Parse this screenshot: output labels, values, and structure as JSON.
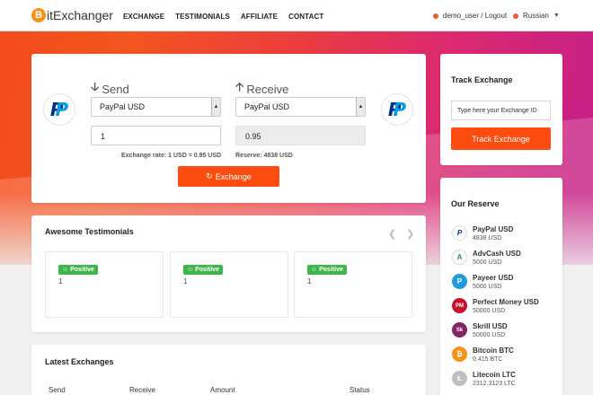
{
  "header": {
    "logo_letter": "B",
    "logo_text": "itExchanger",
    "nav": [
      "EXCHANGE",
      "TESTIMONIALS",
      "AFFILIATE",
      "CONTACT"
    ],
    "user": "demo_user / Logout",
    "language": "Russian"
  },
  "exchange": {
    "send_label": "Send",
    "receive_label": "Receive",
    "send_currency": "PayPal USD",
    "receive_currency": "PayPal USD",
    "send_amount": "1",
    "receive_amount": "0.95",
    "rate_text": "Exchange rate: 1 USD = 0.95 USD",
    "reserve_text": "Reserve: 4838 USD",
    "button_label": "Exchange"
  },
  "track": {
    "title": "Track Exchange",
    "input_placeholder": "Type here your Exchange ID",
    "button_label": "Track Exchange"
  },
  "reserve": {
    "title": "Our Reserve",
    "items": [
      {
        "name": "PayPal USD",
        "amount": "4838 USD",
        "color": "#ffffff",
        "icon": "paypal-icon"
      },
      {
        "name": "AdvCash USD",
        "amount": "5000 USD",
        "color": "#2e8b57",
        "icon": "advcash-icon"
      },
      {
        "name": "Payeer USD",
        "amount": "5000 USD",
        "color": "#1e9be0",
        "icon": "payeer-icon"
      },
      {
        "name": "Perfect Money USD",
        "amount": "50000 USD",
        "color": "#c8102e",
        "icon": "perfect-money-icon"
      },
      {
        "name": "Skrill USD",
        "amount": "50000 USD",
        "color": "#862165",
        "icon": "skrill-icon"
      },
      {
        "name": "Bitcoin BTC",
        "amount": "0.415 BTC",
        "color": "#f7931a",
        "icon": "bitcoin-icon"
      },
      {
        "name": "Litecoin LTC",
        "amount": "2312.3123 LTC",
        "color": "#bfbfbf",
        "icon": "litecoin-icon"
      }
    ]
  },
  "testimonials": {
    "title": "Awesome Testimonials",
    "items": [
      {
        "badge": "Positive",
        "text": "1"
      },
      {
        "badge": "Positive",
        "text": "1"
      },
      {
        "badge": "Positive",
        "text": "1"
      }
    ]
  },
  "latest": {
    "title": "Latest Exchanges",
    "columns": [
      "Send",
      "Receive",
      "Amount",
      "Status"
    ]
  },
  "colors": {
    "accent": "#fc4c10",
    "positive": "#3cb648"
  }
}
